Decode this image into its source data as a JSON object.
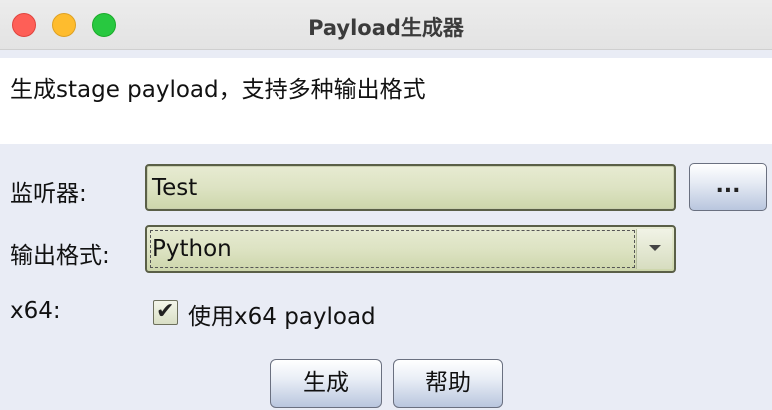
{
  "window": {
    "title": "Payload生成器"
  },
  "description": "生成stage payload，支持多种输出格式",
  "form": {
    "listener_label": "监听器:",
    "listener_value": "Test",
    "browse_label": "...",
    "format_label": "输出格式:",
    "format_value": "Python",
    "x64_label": "x64:",
    "x64_checkbox_label": "使用x64 payload",
    "x64_checked": true,
    "check_glyph": "✔"
  },
  "actions": {
    "generate_label": "生成",
    "help_label": "帮助"
  }
}
